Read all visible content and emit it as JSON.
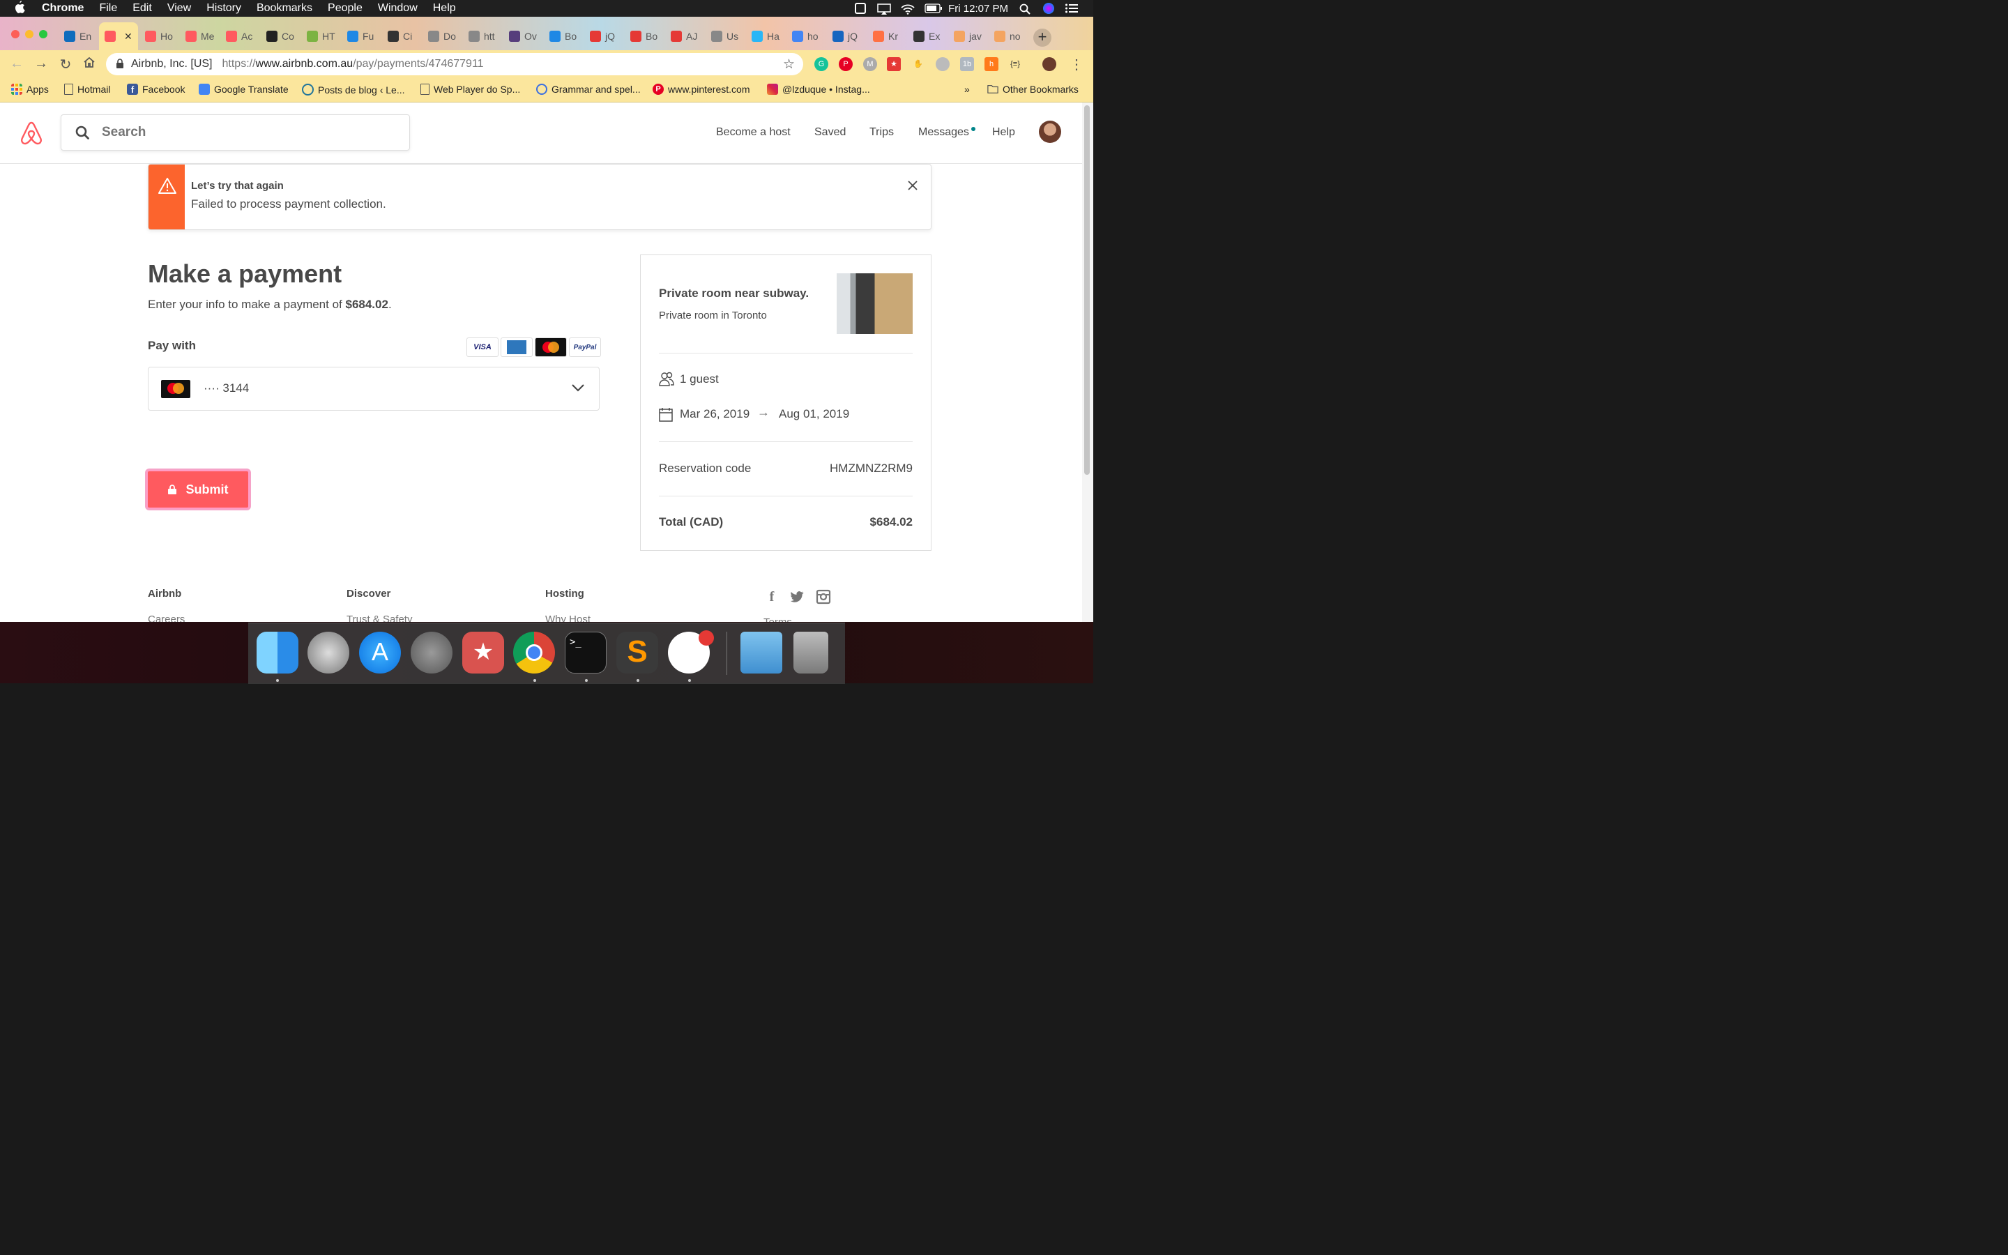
{
  "menubar": {
    "app_name": "Chrome",
    "items": [
      "File",
      "Edit",
      "View",
      "History",
      "Bookmarks",
      "People",
      "Window",
      "Help"
    ],
    "clock": "Fri 12:07 PM"
  },
  "tabs": [
    {
      "label": "En",
      "color": "#0f6cbd"
    },
    {
      "label": "",
      "color": "#ff5a5f",
      "active": true
    },
    {
      "label": "Ho",
      "color": "#ff5a5f"
    },
    {
      "label": "Me",
      "color": "#ff5a5f"
    },
    {
      "label": "Ac",
      "color": "#ff5a5f"
    },
    {
      "label": "Co",
      "color": "#222222"
    },
    {
      "label": "HT",
      "color": "#7cb342"
    },
    {
      "label": "Fu",
      "color": "#1e88e5"
    },
    {
      "label": "Ci",
      "color": "#333333"
    },
    {
      "label": "Do",
      "color": "#888888"
    },
    {
      "label": "htt",
      "color": "#888888"
    },
    {
      "label": "Ov",
      "color": "#563d7c"
    },
    {
      "label": "Bo",
      "color": "#1e88e5"
    },
    {
      "label": "jQ",
      "color": "#e53935"
    },
    {
      "label": "Bo",
      "color": "#e53935"
    },
    {
      "label": "AJ",
      "color": "#e53935"
    },
    {
      "label": "Us",
      "color": "#888888"
    },
    {
      "label": "Ha",
      "color": "#29b6f6"
    },
    {
      "label": "ho",
      "color": "#4285f4"
    },
    {
      "label": "jQ",
      "color": "#1565c0"
    },
    {
      "label": "Kr",
      "color": "#ff7043"
    },
    {
      "label": "Ex",
      "color": "#333333"
    },
    {
      "label": "jav",
      "color": "#f4a460"
    },
    {
      "label": "no",
      "color": "#f4a460"
    }
  ],
  "omnibox": {
    "org": "Airbnb, Inc. [US]",
    "scheme": "https://",
    "host": "www.airbnb.com.au",
    "path": "/pay/payments/474677911"
  },
  "bookmarks": {
    "items": [
      "Apps",
      "Hotmail",
      "Facebook",
      "Google Translate",
      "Posts de blog ‹ Le...",
      "Web Player do Sp...",
      "Grammar and spel...",
      "www.pinterest.com",
      "@lzduque • Instag..."
    ],
    "overflow": "»",
    "other": "Other Bookmarks"
  },
  "header": {
    "search_placeholder": "Search",
    "nav": [
      "Become a host",
      "Saved",
      "Trips",
      "Messages",
      "Help"
    ]
  },
  "alert": {
    "title": "Let’s try that again",
    "message": "Failed to process payment collection."
  },
  "payment": {
    "title": "Make a payment",
    "subtitle_prefix": "Enter your info to make a payment of ",
    "amount": "$684.02",
    "subtitle_suffix": ".",
    "pay_with": "Pay with",
    "card_logos": [
      "VISA",
      "AMEX",
      "mastercard",
      "PayPal"
    ],
    "selected_card": "···· 3144",
    "submit": "Submit"
  },
  "summary": {
    "listing_title": "Private room near subway.",
    "listing_subtitle": "Private room in Toronto",
    "guests": "1 guest",
    "checkin": "Mar 26, 2019",
    "checkout": "Aug 01, 2019",
    "reservation_label": "Reservation code",
    "reservation_code": "HMZMNZ2RM9",
    "total_label": "Total (CAD)",
    "total_value": "$684.02"
  },
  "footer": {
    "columns": [
      {
        "heading": "Airbnb",
        "first_link": "Careers"
      },
      {
        "heading": "Discover",
        "first_link": "Trust & Safety"
      },
      {
        "heading": "Hosting",
        "first_link": "Why Host"
      }
    ],
    "terms": "Terms"
  },
  "colors": {
    "brand": "#ff5a5f",
    "alert": "#fc642d",
    "accent_teal": "#008489",
    "chrome_theme": "#fbe69d"
  }
}
